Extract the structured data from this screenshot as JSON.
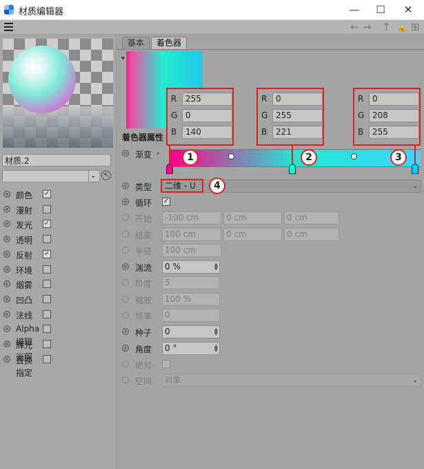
{
  "window": {
    "title": "材质编辑器",
    "minimize": "—",
    "maximize": "☐",
    "close": "✕"
  },
  "toolbar": {
    "menu_icon": "hamburger-icon",
    "back": "←",
    "forward": "→",
    "up": "↑",
    "lock": "🔒",
    "newwin": "⊞"
  },
  "material": {
    "name": "材质.2"
  },
  "channels": [
    {
      "label": "颜色",
      "checked": true
    },
    {
      "label": "漫射",
      "checked": false
    },
    {
      "label": "发光",
      "checked": true
    },
    {
      "label": "透明",
      "checked": false
    },
    {
      "label": "反射",
      "checked": true
    },
    {
      "label": "环境",
      "checked": false
    },
    {
      "label": "烟雾",
      "checked": false
    },
    {
      "label": "凹凸",
      "checked": false
    },
    {
      "label": "法线",
      "checked": false
    },
    {
      "label": "Alpha",
      "checked": false
    },
    {
      "label": "辉光",
      "checked": false
    },
    {
      "label": "置换",
      "checked": false
    }
  ],
  "extra_items": [
    "编辑",
    "光照",
    "指定"
  ],
  "tabs": {
    "basic": "基本",
    "shader": "着色器"
  },
  "shader": {
    "section_title": "着色器属性",
    "gradient_label": "渐变",
    "type_label": "类型",
    "type_value": "二维 - U",
    "cycle_label": "循环",
    "cycle_checked": true,
    "start_label": "开始",
    "start_values": [
      "-100 cm",
      "0 cm",
      "0 cm"
    ],
    "end_label": "结束",
    "end_values": [
      "100 cm",
      "0 cm",
      "0 cm"
    ],
    "radius_label": "半径",
    "radius_value": "100 cm",
    "turbulence_label": "湍流",
    "turbulence_value": "0 %",
    "octaves_label": "阶度",
    "octaves_value": "5",
    "scale_label": "缩放",
    "scale_value": "100 %",
    "freq_label": "频率",
    "freq_value": "0",
    "seed_label": "种子",
    "seed_value": "0",
    "angle_label": "角度",
    "angle_value": "0 °",
    "absolute_label": "绝对",
    "space_label": "空间",
    "space_value": "对象"
  },
  "color_stops": [
    {
      "r": "255",
      "g": "0",
      "b": "140",
      "color": "#ff008c",
      "badge": "1"
    },
    {
      "r": "0",
      "g": "255",
      "b": "221",
      "color": "#00ffdd",
      "badge": "2"
    },
    {
      "r": "0",
      "g": "208",
      "b": "255",
      "color": "#00d0ff",
      "badge": "3"
    }
  ],
  "rgb_labels": {
    "r": "R",
    "g": "G",
    "b": "B"
  },
  "type_badge": "4",
  "accent": "#e02020"
}
